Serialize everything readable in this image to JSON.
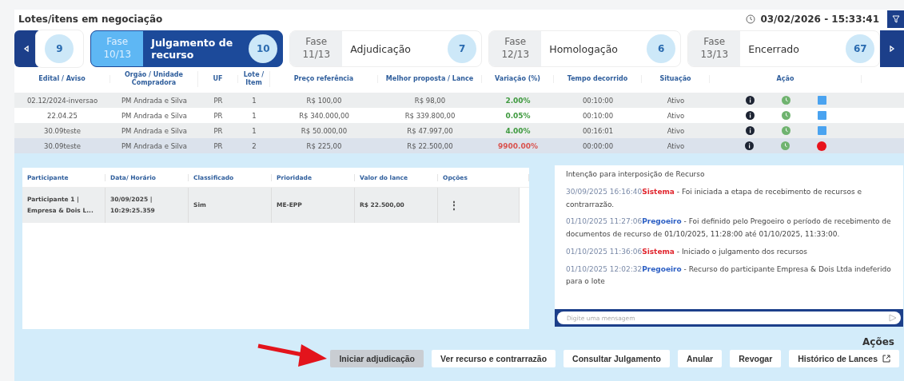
{
  "header": {
    "title": "Lotes/itens em negociação",
    "datetime": "03/02/2026 - 15:33:41"
  },
  "phases": {
    "partial_count": "9",
    "items": [
      {
        "label": "Fase",
        "number": "10/13",
        "name": "Julgamento de recurso",
        "count": "10",
        "selected": true
      },
      {
        "label": "Fase",
        "number": "11/13",
        "name": "Adjudicação",
        "count": "7",
        "selected": false
      },
      {
        "label": "Fase",
        "number": "12/13",
        "name": "Homologação",
        "count": "6",
        "selected": false
      },
      {
        "label": "Fase",
        "number": "13/13",
        "name": "Encerrado",
        "count": "67",
        "selected": false
      }
    ]
  },
  "lots": {
    "columns": [
      "Edital / Aviso",
      "Orgão / Unidade Compradora",
      "UF",
      "Lote / Item",
      "Preço referência",
      "Melhor proposta / Lance",
      "Variação (%)",
      "Tempo decorrido",
      "Situação",
      "Ação"
    ],
    "rows": [
      {
        "edital": "02.12/2024-inversao",
        "orgao": "PM Andrada e Silva",
        "uf": "PR",
        "lote": "1",
        "preco": "R$ 100,00",
        "melhor": "R$ 98,00",
        "variacao": "2.00%",
        "color": "#3f9a3f",
        "tempo": "00:10:00",
        "situacao": "Ativo",
        "kind": "square",
        "selected": false
      },
      {
        "edital": "22.04.25",
        "orgao": "PM Andrada e Silva",
        "uf": "PR",
        "lote": "1",
        "preco": "R$ 340.000,00",
        "melhor": "R$ 339.800,00",
        "variacao": "0.05%",
        "color": "#3f9a3f",
        "tempo": "00:10:00",
        "situacao": "Ativo",
        "kind": "square",
        "selected": false
      },
      {
        "edital": "30.09teste",
        "orgao": "PM Andrada e Silva",
        "uf": "PR",
        "lote": "1",
        "preco": "R$ 50.000,00",
        "melhor": "R$ 47.997,00",
        "variacao": "4.00%",
        "color": "#3f9a3f",
        "tempo": "00:16:01",
        "situacao": "Ativo",
        "kind": "square",
        "selected": false
      },
      {
        "edital": "30.09teste",
        "orgao": "PM Andrada e Silva",
        "uf": "PR",
        "lote": "2",
        "preco": "R$ 225,00",
        "melhor": "R$ 22.500,00",
        "variacao": "9900.00%",
        "color": "#d9534f",
        "tempo": "00:00:00",
        "situacao": "Ativo",
        "kind": "dot",
        "selected": true
      }
    ]
  },
  "bids": {
    "columns": [
      "Participante",
      "Data/ Horário",
      "Classificado",
      "Prioridade",
      "Valor do lance",
      "Opções"
    ],
    "rows": [
      {
        "participante": "Participante 1 | Empresa & Dois L...",
        "data": "30/09/2025 | 10:29:25.359",
        "classificado": "Sim",
        "prioridade": "ME-EPP",
        "valor": "R$ 22.500,00",
        "options": "⋮"
      }
    ]
  },
  "chat": {
    "intro": "Intenção para interposição de Recurso",
    "messages": [
      {
        "time": "30/09/2025 16:16:40",
        "author": "Sistema",
        "kind": "system",
        "text": " - Foi iniciada a etapa de recebimento de recursos e contrarrazão."
      },
      {
        "time": "01/10/2025 11:27:06",
        "author": "Pregoeiro",
        "kind": "agent",
        "text": " - Foi definido pelo Pregoeiro o período de recebimento de documentos de recurso de 01/10/2025, 11:28:00 até 01/10/2025, 11:33:00."
      },
      {
        "time": "01/10/2025 11:36:06",
        "author": "Sistema",
        "kind": "system",
        "text": " - Iniciado o julgamento dos recursos"
      },
      {
        "time": "01/10/2025 12:02:32",
        "author": "Pregoeiro",
        "kind": "agent",
        "text": " - Recurso do participante Empresa & Dois Ltda indeferido para o lote"
      }
    ],
    "placeholder": "Digite uma mensagem"
  },
  "actions": {
    "title": "Ações",
    "buttons": [
      {
        "label": "Iniciar adjudicação",
        "hovered": true,
        "external": false
      },
      {
        "label": "Ver recurso e contrarrazão",
        "hovered": false,
        "external": false
      },
      {
        "label": "Consultar Julgamento",
        "hovered": false,
        "external": false
      },
      {
        "label": "Anular",
        "hovered": false,
        "external": false
      },
      {
        "label": "Revogar",
        "hovered": false,
        "external": false
      },
      {
        "label": "Histórico de Lances",
        "hovered": false,
        "external": true
      }
    ]
  }
}
